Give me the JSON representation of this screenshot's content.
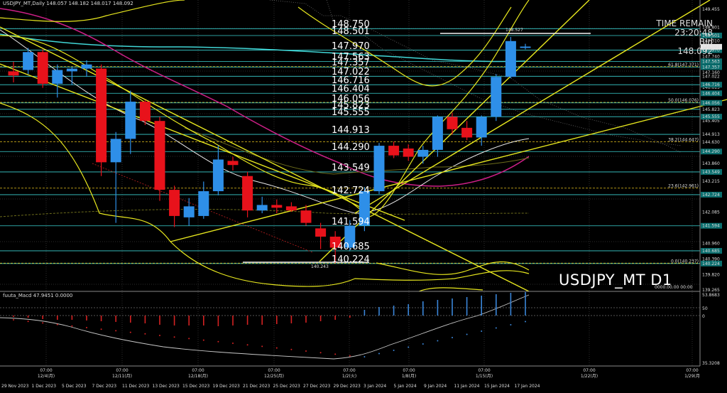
{
  "header": {
    "chart_label": "USDJPY_MT,Daily  148.057 148.182 148.017 148.092",
    "macd_label": "fuuta_Macd 47.9451  0.0000"
  },
  "symbol_label": "USDJPY_MT D1",
  "time_remain": {
    "title": "TIME REMAIN",
    "value": "23:20:48",
    "bid_label": "Bid",
    "bid_value": "148.092"
  },
  "colors": {
    "bull": "#2e8fe8",
    "bear": "#e8121b",
    "ma_cyan": "#41d7d7",
    "ma_magenta": "#cc1f86",
    "ma_white": "#e8e8e8",
    "trend_yellow": "#e6e61e",
    "macd_red": "#d42222",
    "macd_blue": "#3a86d9"
  },
  "level_labels": [
    "148.750",
    "148.501",
    "147.970",
    "147.563",
    "147.357",
    "147.022",
    "146.716",
    "146.404",
    "146.056",
    "145.823",
    "145.555",
    "144.913",
    "144.290",
    "143.549",
    "142.724",
    "141.594",
    "140.685",
    "140.224"
  ],
  "price_axis": [
    "149.455",
    "148.801",
    "148.501",
    "148.310",
    "147.970",
    "147.740",
    "147.563",
    "147.357",
    "147.160",
    "147.022",
    "146.716",
    "146.615",
    "146.404",
    "146.056",
    "145.823",
    "145.555",
    "145.405",
    "144.913",
    "144.630",
    "144.290",
    "143.860",
    "143.549",
    "143.215",
    "142.724",
    "142.085",
    "141.594",
    "140.960",
    "140.685",
    "140.390",
    "140.224",
    "139.820",
    "139.265"
  ],
  "macd_axis": [
    "53.8683",
    "50",
    "0",
    "35.3208"
  ],
  "fib_labels": [
    "61.8(147.371)",
    "50.0(146.076)",
    "38.2(144.647)",
    "23.6(142.961)",
    "0.0(140.237)"
  ],
  "annotations": {
    "high_label": "148.527",
    "low_label": "140.243",
    "zero_label": "0000.00.00 00:00"
  },
  "time_axis": {
    "hours": [
      {
        "t": "07:00",
        "d": "12/4(月)"
      },
      {
        "t": "07:00",
        "d": "12/11(月)"
      },
      {
        "t": "07:00",
        "d": "12/18(月)"
      },
      {
        "t": "07:00",
        "d": "12/25(月)"
      },
      {
        "t": "07:00",
        "d": "1/2(火)"
      },
      {
        "t": "07:00",
        "d": "1/8(月)"
      },
      {
        "t": "07:00",
        "d": "1/15(月)"
      },
      {
        "t": "07:00",
        "d": "1/22(月)"
      },
      {
        "t": "07:00",
        "d": "1/29(月"
      }
    ],
    "dates": [
      "29 Nov 2023",
      "1 Dec 2023",
      "5 Dec 2023",
      "7 Dec 2023",
      "11 Dec 2023",
      "13 Dec 2023",
      "15 Dec 2023",
      "19 Dec 2023",
      "21 Dec 2023",
      "25 Dec 2023",
      "27 Dec 2023",
      "29 Dec 2023",
      "3 Jan 2024",
      "5 Jan 2024",
      "9 Jan 2024",
      "11 Jan 2024",
      "15 Jan 2024",
      "17 Jan 2024"
    ]
  },
  "chart_data": {
    "type": "candlestick",
    "title": "USDJPY_MT D1",
    "ylim": [
      139.265,
      149.455
    ],
    "candles": [
      {
        "o": 147.2,
        "h": 147.55,
        "l": 146.8,
        "c": 147.05
      },
      {
        "o": 147.25,
        "h": 148.05,
        "l": 147.1,
        "c": 147.9
      },
      {
        "o": 147.9,
        "h": 148.0,
        "l": 146.6,
        "c": 146.75
      },
      {
        "o": 146.75,
        "h": 147.45,
        "l": 146.25,
        "c": 147.25
      },
      {
        "o": 147.2,
        "h": 147.35,
        "l": 146.7,
        "c": 147.3
      },
      {
        "o": 147.3,
        "h": 147.6,
        "l": 147.0,
        "c": 147.45
      },
      {
        "o": 147.3,
        "h": 147.45,
        "l": 143.4,
        "c": 143.9
      },
      {
        "o": 143.9,
        "h": 145.0,
        "l": 141.7,
        "c": 144.75
      },
      {
        "o": 144.75,
        "h": 146.5,
        "l": 144.2,
        "c": 146.1
      },
      {
        "o": 146.1,
        "h": 146.15,
        "l": 145.25,
        "c": 145.4
      },
      {
        "o": 145.4,
        "h": 145.55,
        "l": 142.5,
        "c": 142.9
      },
      {
        "o": 142.9,
        "h": 143.05,
        "l": 141.55,
        "c": 141.95
      },
      {
        "o": 141.9,
        "h": 142.6,
        "l": 141.6,
        "c": 142.3
      },
      {
        "o": 141.95,
        "h": 143.2,
        "l": 141.85,
        "c": 142.85
      },
      {
        "o": 142.85,
        "h": 144.5,
        "l": 142.7,
        "c": 144.0
      },
      {
        "o": 143.95,
        "h": 144.1,
        "l": 143.6,
        "c": 143.8
      },
      {
        "o": 143.4,
        "h": 143.55,
        "l": 141.9,
        "c": 142.15
      },
      {
        "o": 142.15,
        "h": 142.65,
        "l": 142.05,
        "c": 142.35
      },
      {
        "o": 142.35,
        "h": 142.55,
        "l": 142.05,
        "c": 142.25
      },
      {
        "o": 142.3,
        "h": 142.45,
        "l": 142.1,
        "c": 142.15
      },
      {
        "o": 142.15,
        "h": 142.35,
        "l": 141.6,
        "c": 141.7
      },
      {
        "o": 141.5,
        "h": 141.7,
        "l": 140.75,
        "c": 141.2
      },
      {
        "o": 141.2,
        "h": 141.4,
        "l": 140.24,
        "c": 140.8
      },
      {
        "o": 140.8,
        "h": 141.8,
        "l": 140.7,
        "c": 141.6
      },
      {
        "o": 141.6,
        "h": 143.0,
        "l": 141.4,
        "c": 142.85
      },
      {
        "o": 142.85,
        "h": 144.6,
        "l": 142.75,
        "c": 144.5
      },
      {
        "o": 144.5,
        "h": 144.65,
        "l": 144.05,
        "c": 144.15
      },
      {
        "o": 144.4,
        "h": 144.55,
        "l": 143.95,
        "c": 144.1
      },
      {
        "o": 144.1,
        "h": 144.5,
        "l": 143.85,
        "c": 144.35
      },
      {
        "o": 144.35,
        "h": 145.6,
        "l": 144.1,
        "c": 145.55
      },
      {
        "o": 145.55,
        "h": 145.7,
        "l": 144.9,
        "c": 145.1
      },
      {
        "o": 145.15,
        "h": 145.4,
        "l": 144.7,
        "c": 144.8
      },
      {
        "o": 144.8,
        "h": 145.6,
        "l": 144.5,
        "c": 145.55
      },
      {
        "o": 145.55,
        "h": 147.1,
        "l": 145.4,
        "c": 147.0
      },
      {
        "o": 147.0,
        "h": 148.45,
        "l": 146.95,
        "c": 148.3
      },
      {
        "o": 148.05,
        "h": 148.2,
        "l": 148.0,
        "c": 148.1
      }
    ]
  }
}
